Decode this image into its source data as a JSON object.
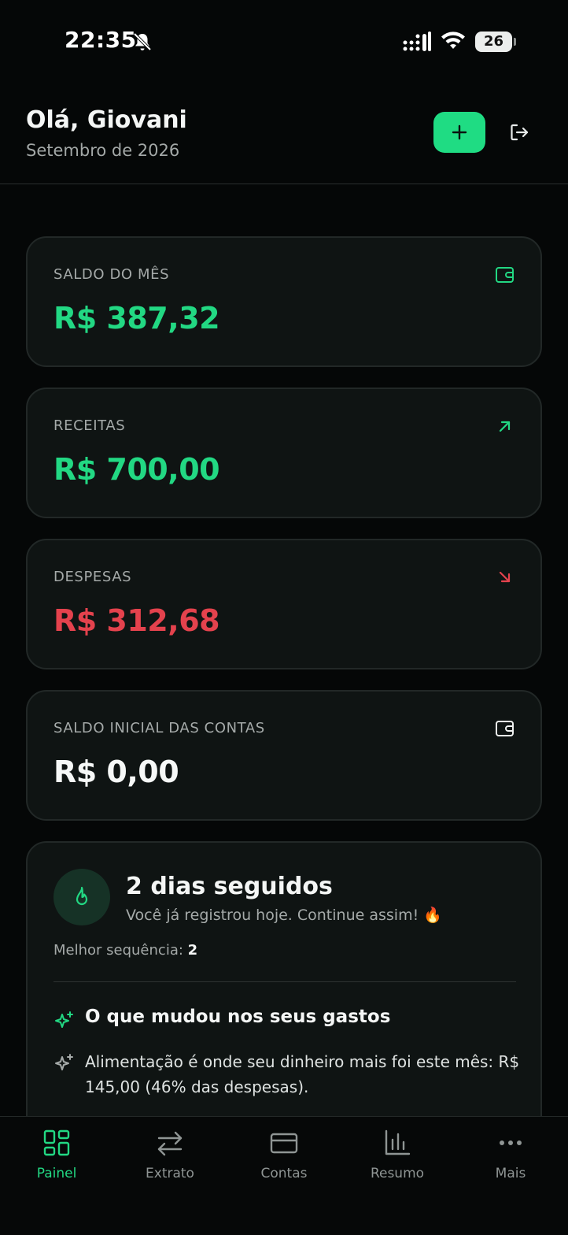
{
  "status_bar": {
    "time": "22:35",
    "battery": "26"
  },
  "header": {
    "greeting": "Olá, Giovani",
    "period": "Setembro de 2026",
    "add_icon": "plus-icon",
    "logout_icon": "logout-icon"
  },
  "stats": [
    {
      "label": "SALDO DO MÊS",
      "value": "R$ 387,32",
      "icon": "wallet-icon",
      "color": "#22d883"
    },
    {
      "label": "RECEITAS",
      "value": "R$ 700,00",
      "icon": "arrow-up-right-icon",
      "color": "#22d883"
    },
    {
      "label": "DESPESAS",
      "value": "R$ 312,68",
      "icon": "arrow-down-right-icon",
      "color": "#e4424d"
    },
    {
      "label": "SALDO INICIAL DAS CONTAS",
      "value": "R$ 0,00",
      "icon": "wallet-icon",
      "color": "#f6f8f7"
    }
  ],
  "streak": {
    "title": "2 dias seguidos",
    "subtitle": "Você já registrou hoje. Continue assim! 🔥",
    "best_label": "Melhor sequência:",
    "best_value": "2"
  },
  "insights": {
    "title": "O que mudou nos seus gastos",
    "items": [
      "Alimentação é onde seu dinheiro mais foi este mês: R$ 145,00 (46% das despesas)."
    ]
  },
  "nav": {
    "active": "Painel",
    "items": [
      {
        "label": "Painel",
        "icon": "dashboard-icon"
      },
      {
        "label": "Extrato",
        "icon": "transfer-arrows-icon"
      },
      {
        "label": "Contas",
        "icon": "card-icon"
      },
      {
        "label": "Resumo",
        "icon": "bar-chart-icon"
      },
      {
        "label": "Mais",
        "icon": "more-dots-icon"
      }
    ]
  },
  "colors": {
    "accent": "#1fdc83",
    "income": "#22d883",
    "expense": "#e4424d",
    "background": "#050707",
    "card": "#0f1413"
  }
}
